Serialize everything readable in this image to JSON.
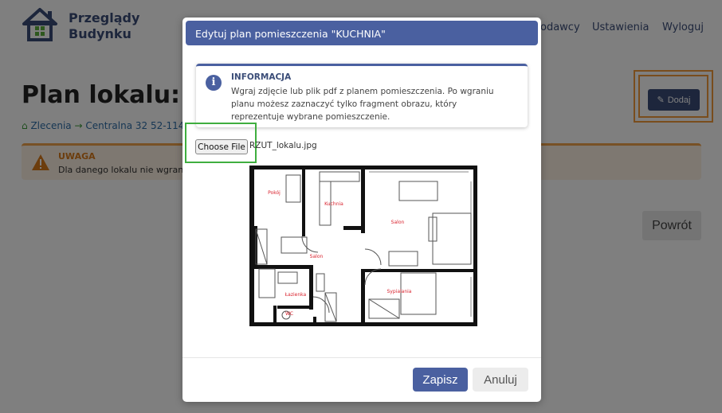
{
  "app": {
    "logo_line1": "Przeglądy",
    "logo_line2": "Budynku",
    "brand_color": "#3b4d78"
  },
  "nav": {
    "items": [
      "odawcy",
      "Ustawienia",
      "Wyloguj"
    ]
  },
  "page": {
    "title": "Plan lokalu: KU",
    "breadcrumb": {
      "item1": "Zlecenia",
      "item2": "Centralna 32 52-114 W"
    },
    "alert": {
      "title": "UWAGA",
      "text": "Dla danego lokalu nie wgrano pl"
    },
    "add_button": "Dodaj",
    "back_button": "Powrót"
  },
  "modal": {
    "title": "Edytuj plan pomieszczenia \"KUCHNIA\"",
    "info_title": "INFORMACJA",
    "info_text": "Wgraj zdjęcie lub plik pdf z planem pomieszczenia. Po wgraniu planu możesz zaznaczyć tylko fragment obrazu, który reprezentuje wybrane pomieszczenie.",
    "file_button": "Choose File",
    "file_name": "RZUT_lokalu.jpg",
    "save_button": "Zapisz",
    "cancel_button": "Anuluj",
    "header_color": "#4a60a0"
  },
  "floor_plan": {
    "rooms": {
      "pokoj": "Pokój",
      "kuchnia": "Kuchnia",
      "salon_right": "Salon",
      "salon_center": "Salon",
      "lazienka": "Łazienka",
      "sypialnia": "Sypialania",
      "wc": "WC"
    },
    "label_color": "#d9232e"
  }
}
